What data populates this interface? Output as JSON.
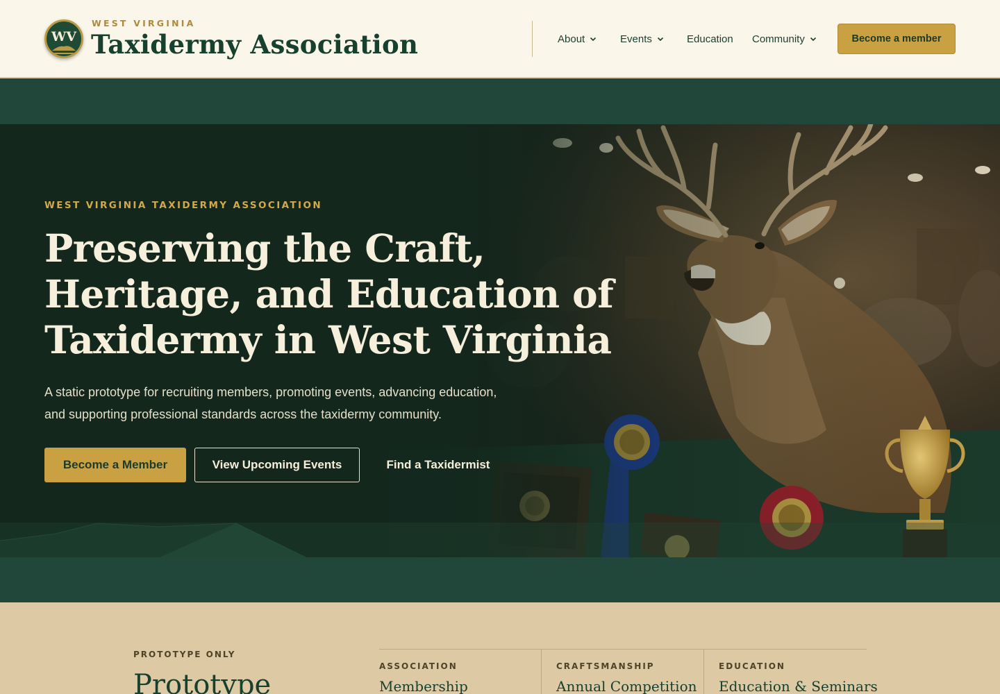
{
  "header": {
    "logo_text": "WV",
    "kicker": "WEST VIRGINIA",
    "title": "Taxidermy Association",
    "nav": [
      {
        "label": "About",
        "has_dropdown": true
      },
      {
        "label": "Events",
        "has_dropdown": true
      },
      {
        "label": "Education",
        "has_dropdown": false
      },
      {
        "label": "Community",
        "has_dropdown": true
      }
    ],
    "cta_label": "Become a member"
  },
  "hero": {
    "kicker": "WEST VIRGINIA TAXIDERMY ASSOCIATION",
    "title_lines": [
      "Preserving the Craft,",
      "Heritage, and Education of",
      "Taxidermy in West Virginia"
    ],
    "description_lines": [
      "A static prototype for recruiting members, promoting events, advancing education,",
      "and supporting professional standards across the taxidermy community."
    ],
    "buttons": {
      "primary": "Become a Member",
      "secondary": "View Upcoming Events",
      "link": "Find a Taxidermist"
    }
  },
  "info": {
    "kicker": "PROTOTYPE ONLY",
    "heading": "Prototype",
    "cards": [
      {
        "kicker": "ASSOCIATION",
        "title": "Membership"
      },
      {
        "kicker": "CRAFTSMANSHIP",
        "title": "Annual Competition"
      },
      {
        "kicker": "EDUCATION",
        "title": "Education & Seminars"
      }
    ]
  },
  "colors": {
    "forest": "#17402f",
    "gold": "#c9a142",
    "cream": "#faf6ea",
    "sand": "#ddc9a3"
  }
}
